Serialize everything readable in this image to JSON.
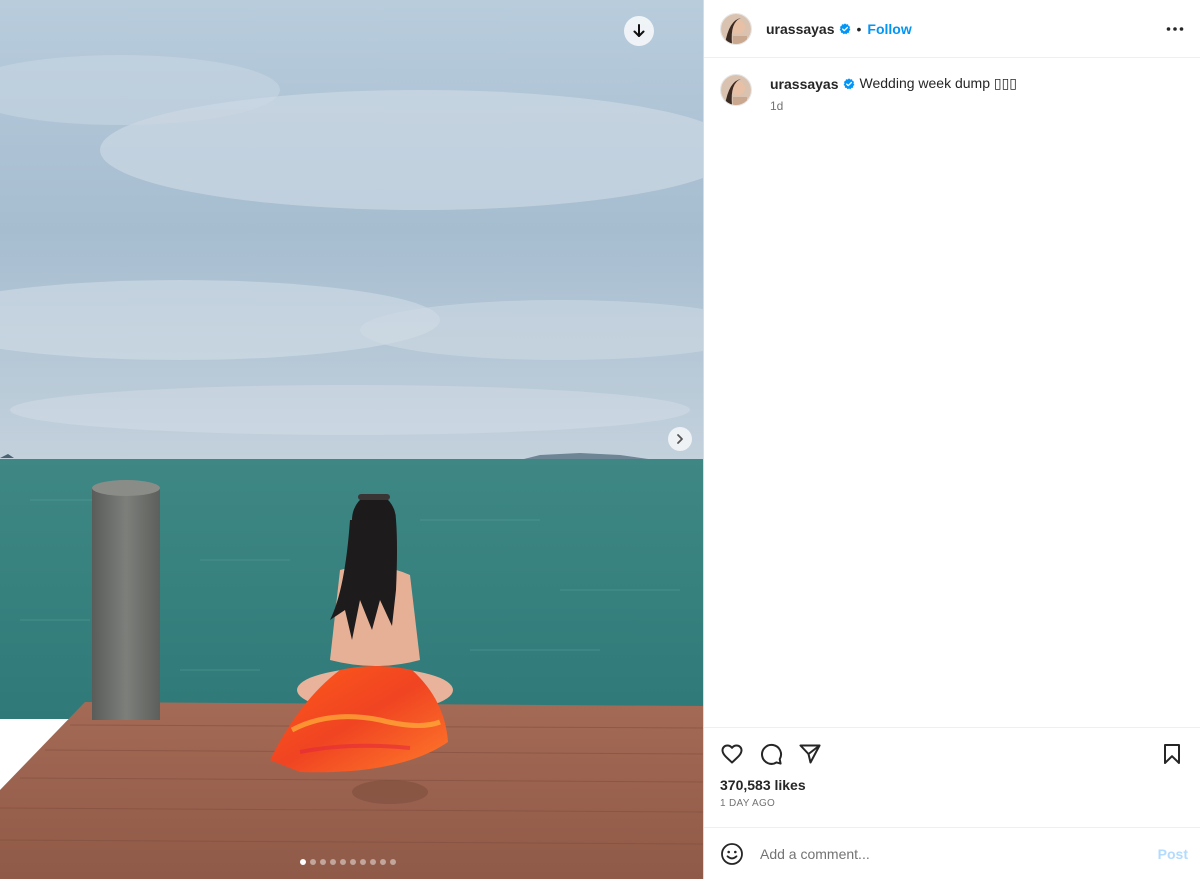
{
  "post": {
    "author": {
      "username": "urassayas",
      "verified": true
    },
    "header": {
      "separator": "•",
      "follow_label": "Follow",
      "more_icon": "more-horizontal-icon"
    },
    "caption": {
      "username": "urassayas",
      "text": "Wedding week dump ▯▯▯",
      "time_ago": "1d"
    },
    "media": {
      "type": "carousel",
      "total_slides": 10,
      "active_slide": 1,
      "download_icon": "arrow-down-icon",
      "next_icon": "chevron-right-icon"
    },
    "actions": {
      "like_icon": "heart-icon",
      "comment_icon": "comment-icon",
      "share_icon": "send-icon",
      "save_icon": "bookmark-icon"
    },
    "likes_text": "370,583 likes",
    "date_text": "1 DAY AGO",
    "comment_box": {
      "placeholder": "Add a comment...",
      "post_label": "Post",
      "emoji_icon": "smiley-icon"
    }
  },
  "colors": {
    "link_blue": "#0095f6",
    "verified_blue": "#0095f6",
    "post_disabled": "#b3dbff",
    "muted_text": "#737373"
  }
}
